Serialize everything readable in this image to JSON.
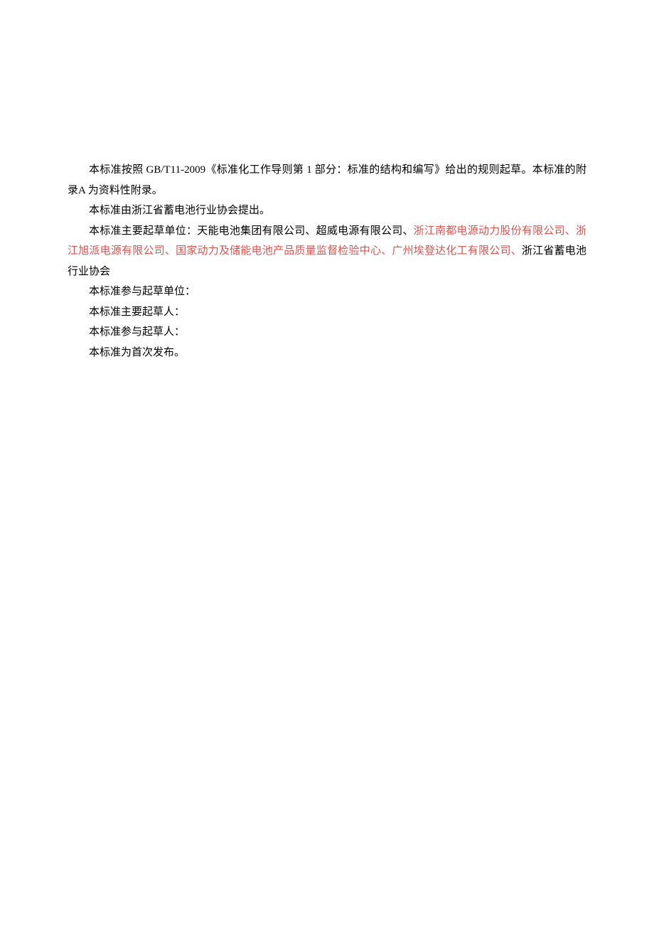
{
  "paragraphs": {
    "p1": "本标准按照 GB/T11-2009《标准化工作导则第 1 部分：标准的结构和编写》给出的规则起草。本标准的附录A 为资料性附录。",
    "p2": "本标准由浙江省蓄电池行业协会提出。",
    "p3_prefix": "本标准主要起草单位：天能电池集团有限公司、超威电源有限公司、",
    "p3_red": "浙江南都电源动力股份有限公司、浙江旭派电源有限公司、国家动力及储能电池产品质量监督检验中心、广州埃登达化工有限公司、",
    "p3_suffix": "浙江省蓄电池行业协会",
    "p4": "本标准参与起草单位：",
    "p5": "本标准主要起草人：",
    "p6": "本标准参与起草人：",
    "p7": "本标准为首次发布。"
  }
}
